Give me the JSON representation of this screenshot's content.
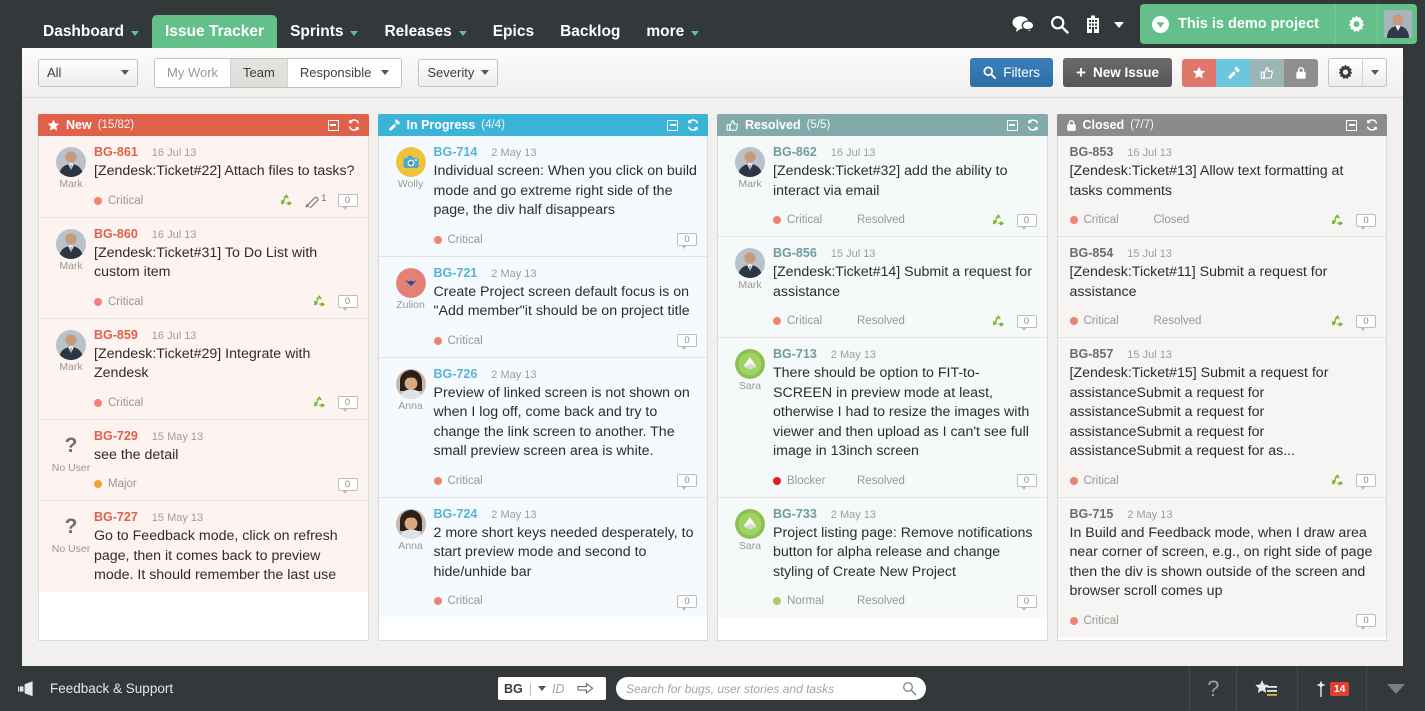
{
  "topnav": {
    "items": [
      {
        "label": "Dashboard",
        "caret": true,
        "active": false
      },
      {
        "label": "Issue Tracker",
        "caret": false,
        "active": true
      },
      {
        "label": "Sprints",
        "caret": true,
        "active": false
      },
      {
        "label": "Releases",
        "caret": true,
        "active": false
      },
      {
        "label": "Epics",
        "caret": false,
        "active": false
      },
      {
        "label": "Backlog",
        "caret": false,
        "active": false
      },
      {
        "label": "more",
        "caret": true,
        "active": false
      }
    ],
    "icons": [
      "chat-icon",
      "search-icon",
      "building-icon"
    ],
    "project_name": "This is demo project",
    "project_gear": "gear-icon",
    "avatar": "user-avatar"
  },
  "toolbar": {
    "all_select": "All",
    "my_work": "My Work",
    "team": "Team",
    "responsible": "Responsible",
    "severity": "Severity",
    "filters": "Filters",
    "new_issue": "New Issue",
    "flags": [
      "star-icon",
      "hammer-icon",
      "thumbs-up-icon",
      "lock-icon"
    ],
    "gear": "gear-icon"
  },
  "columns": [
    {
      "key": "new",
      "icon": "star-icon",
      "title": "New",
      "count": "(15/82)",
      "header_color": "#e0614a",
      "cards": [
        {
          "id": "BG-861",
          "date": "16 Jul 13",
          "title": "[Zendesk:Ticket#22] Attach files to tasks?",
          "avatar": "mark-photo",
          "avatar_name": "Mark",
          "severity": "Critical",
          "severity_color": "#ef8470",
          "state": "",
          "recycle": true,
          "attachments": "1",
          "comments": "0"
        },
        {
          "id": "BG-860",
          "date": "16 Jul 13",
          "title": "[Zendesk:Ticket#31] To Do List with custom item",
          "avatar": "mark-photo",
          "avatar_name": "Mark",
          "severity": "Critical",
          "severity_color": "#ef8470",
          "state": "",
          "recycle": true,
          "attachments": "",
          "comments": "0"
        },
        {
          "id": "BG-859",
          "date": "16 Jul 13",
          "title": "[Zendesk:Ticket#29] Integrate with Zendesk",
          "avatar": "mark-photo",
          "avatar_name": "Mark",
          "severity": "Critical",
          "severity_color": "#ef8470",
          "state": "",
          "recycle": true,
          "attachments": "",
          "comments": "0"
        },
        {
          "id": "BG-729",
          "date": "15 May 13",
          "title": "see the detail",
          "avatar": "question-mark",
          "avatar_name": "No User",
          "severity": "Major",
          "severity_color": "#f0a22e",
          "state": "",
          "recycle": false,
          "attachments": "",
          "comments": "0"
        },
        {
          "id": "BG-727",
          "date": "15 May 13",
          "title": "Go to Feedback mode, click on refresh page, then it comes back to preview mode. It should remember the last use",
          "avatar": "question-mark",
          "avatar_name": "No User",
          "severity": "",
          "severity_color": "",
          "state": "",
          "recycle": false,
          "attachments": "",
          "comments": ""
        }
      ]
    },
    {
      "key": "prog",
      "icon": "hammer-icon",
      "title": "In Progress",
      "count": "(4/4)",
      "header_color": "#3cb4d8",
      "cards": [
        {
          "id": "BG-714",
          "date": "2 May 13",
          "title": "Individual screen: When you click on build mode and go extreme right side of the page, the div half disappears",
          "avatar": "wolly-photo",
          "avatar_name": "Wolly",
          "severity": "Critical",
          "severity_color": "#ef8470",
          "state": "",
          "recycle": false,
          "attachments": "",
          "comments": "0"
        },
        {
          "id": "BG-721",
          "date": "2 May 13",
          "title": "Create Project screen default focus is on \"Add member\"it should be on project title",
          "avatar": "zulion-photo",
          "avatar_name": "Zulion",
          "severity": "Critical",
          "severity_color": "#ef8470",
          "state": "",
          "recycle": false,
          "attachments": "",
          "comments": "0"
        },
        {
          "id": "BG-726",
          "date": "2 May 13",
          "title": "Preview of linked screen is not shown on when I log off, come back and try to change the link screen to another. The small preview screen area is white.",
          "avatar": "anna-photo",
          "avatar_name": "Anna",
          "severity": "Critical",
          "severity_color": "#ef8470",
          "state": "",
          "recycle": false,
          "attachments": "",
          "comments": "0"
        },
        {
          "id": "BG-724",
          "date": "2 May 13",
          "title": "2 more short keys needed desperately, to start preview mode and second to hide/unhide bar",
          "avatar": "anna-photo",
          "avatar_name": "Anna",
          "severity": "Critical",
          "severity_color": "#ef8470",
          "state": "",
          "recycle": false,
          "attachments": "",
          "comments": "0"
        }
      ]
    },
    {
      "key": "res",
      "icon": "thumbs-up-icon",
      "title": "Resolved",
      "count": "(5/5)",
      "header_color": "#83aaab",
      "cards": [
        {
          "id": "BG-862",
          "date": "16 Jul 13",
          "title": "[Zendesk:Ticket#32] add the ability to interact via email",
          "avatar": "mark-photo",
          "avatar_name": "Mark",
          "severity": "Critical",
          "severity_color": "#ef8470",
          "state": "Resolved",
          "recycle": true,
          "attachments": "",
          "comments": "0"
        },
        {
          "id": "BG-856",
          "date": "15 Jul 13",
          "title": "[Zendesk:Ticket#14] Submit a request for assistance",
          "avatar": "mark-photo",
          "avatar_name": "Mark",
          "severity": "Critical",
          "severity_color": "#ef8470",
          "state": "Resolved",
          "recycle": true,
          "attachments": "",
          "comments": "0"
        },
        {
          "id": "BG-713",
          "date": "2 May 13",
          "title": "There should be option to FIT-to-SCREEN in preview mode at least, otherwise I had to resize the images with viewer and then upload as I can't see full image in 13inch screen",
          "avatar": "sara-photo",
          "avatar_name": "Sara",
          "severity": "Blocker",
          "severity_color": "#e02020",
          "state": "Resolved",
          "recycle": false,
          "attachments": "",
          "comments": "0"
        },
        {
          "id": "BG-733",
          "date": "2 May 13",
          "title": "Project listing page: Remove notifications button for alpha release and change styling of Create New Project",
          "avatar": "sara-photo",
          "avatar_name": "Sara",
          "severity": "Normal",
          "severity_color": "#a8cf5c",
          "state": "Resolved",
          "recycle": false,
          "attachments": "",
          "comments": "0"
        }
      ]
    },
    {
      "key": "closed",
      "icon": "lock-icon",
      "title": "Closed",
      "count": "(7/7)",
      "header_color": "#8b8b89",
      "cards": [
        {
          "id": "BG-853",
          "date": "16 Jul 13",
          "title": "[Zendesk:Ticket#13] Allow text formatting at tasks comments",
          "avatar": "",
          "avatar_name": "",
          "severity": "Critical",
          "severity_color": "#ef8470",
          "state": "Closed",
          "recycle": true,
          "attachments": "",
          "comments": "0"
        },
        {
          "id": "BG-854",
          "date": "15 Jul 13",
          "title": "[Zendesk:Ticket#11] Submit a request for assistance",
          "avatar": "",
          "avatar_name": "",
          "severity": "Critical",
          "severity_color": "#ef8470",
          "state": "Resolved",
          "recycle": true,
          "attachments": "",
          "comments": "0"
        },
        {
          "id": "BG-857",
          "date": "15 Jul 13",
          "title": "[Zendesk:Ticket#15] Submit a request for assistanceSubmit a request for assistanceSubmit a request for assistanceSubmit a request for assistanceSubmit a request for as...",
          "avatar": "",
          "avatar_name": "",
          "severity": "Critical",
          "severity_color": "#ef8470",
          "state": "",
          "recycle": true,
          "attachments": "",
          "comments": "0"
        },
        {
          "id": "BG-715",
          "date": "2 May 13",
          "title": "In Build and Feedback mode, when I draw area near corner of screen, e.g., on right side of page then the div is shown outside of the screen and browser scroll comes up",
          "avatar": "",
          "avatar_name": "",
          "severity": "Critical",
          "severity_color": "#ef8470",
          "state": "",
          "recycle": false,
          "attachments": "",
          "comments": "0"
        }
      ]
    }
  ],
  "bottombar": {
    "feedback": "Feedback & Support",
    "id_prefix": "BG",
    "id_placeholder": "ID",
    "search_placeholder": "Search for bugs, user stories and tasks",
    "help": "?",
    "notification_count": "14"
  }
}
